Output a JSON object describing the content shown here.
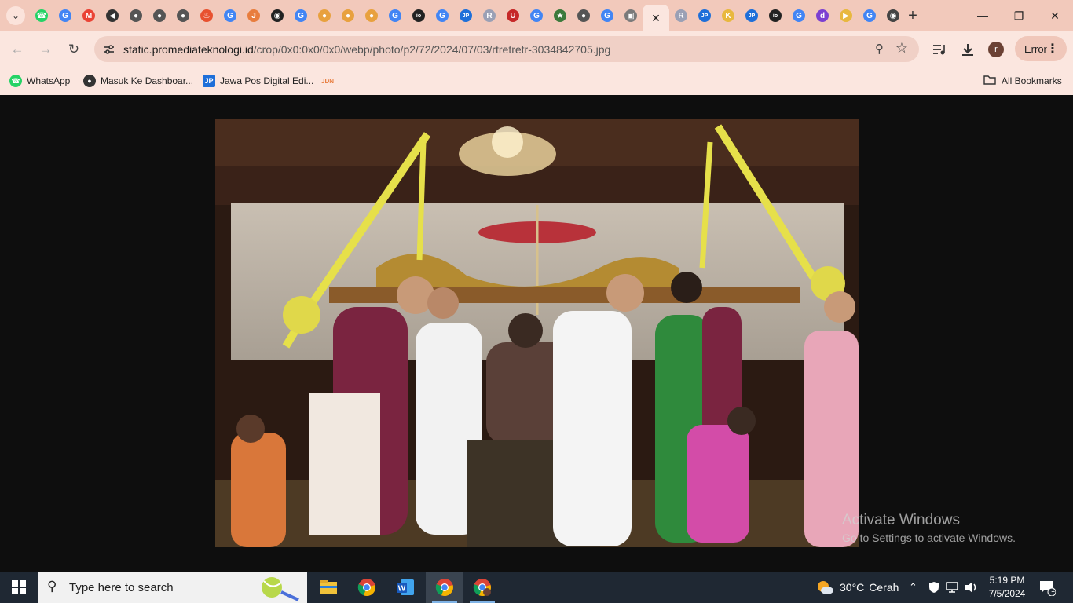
{
  "browser": {
    "tabs": [
      {
        "icon": "whatsapp-icon",
        "color": "#25d366"
      },
      {
        "icon": "google-icon",
        "color": "#4285f4"
      },
      {
        "icon": "gmail-icon",
        "color": "#ea4335"
      },
      {
        "icon": "speaker-icon",
        "color": "#333333"
      },
      {
        "icon": "globe-icon",
        "color": "#555555"
      },
      {
        "icon": "globe-icon",
        "color": "#555555"
      },
      {
        "icon": "globe-icon",
        "color": "#555555"
      },
      {
        "icon": "fire-icon",
        "color": "#e8512f"
      },
      {
        "icon": "google-icon",
        "color": "#4285f4"
      },
      {
        "icon": "jdn-icon",
        "color": "#e87d3e"
      },
      {
        "icon": "github-icon",
        "color": "#222222"
      },
      {
        "icon": "google-icon",
        "color": "#4285f4"
      },
      {
        "icon": "ball-icon",
        "color": "#e8a13e"
      },
      {
        "icon": "ball-icon",
        "color": "#e8a13e"
      },
      {
        "icon": "ball-icon",
        "color": "#e8a13e"
      },
      {
        "icon": "google-icon",
        "color": "#4285f4"
      },
      {
        "icon": "io-icon",
        "color": "#222222"
      },
      {
        "icon": "google-icon",
        "color": "#4285f4"
      },
      {
        "icon": "jp-icon",
        "color": "#1e6fd9"
      },
      {
        "icon": "r-icon",
        "color": "#9aa0b5"
      },
      {
        "icon": "u-icon",
        "color": "#c62828"
      },
      {
        "icon": "google-icon",
        "color": "#4285f4"
      },
      {
        "icon": "emblem-icon",
        "color": "#3c7a3c"
      },
      {
        "icon": "globe-icon",
        "color": "#555555"
      },
      {
        "icon": "google-icon",
        "color": "#4285f4"
      },
      {
        "icon": "image-icon",
        "color": "#7a7a7a"
      }
    ],
    "tabs_right": [
      {
        "icon": "r-icon",
        "color": "#9aa0b5"
      },
      {
        "icon": "jp-icon",
        "color": "#1e6fd9"
      },
      {
        "icon": "k-icon",
        "color": "#e8b83e"
      },
      {
        "icon": "jp-icon",
        "color": "#1e6fd9"
      },
      {
        "icon": "io-icon",
        "color": "#222222"
      },
      {
        "icon": "google-icon",
        "color": "#4285f4"
      },
      {
        "icon": "d-icon",
        "color": "#7b3fd1"
      },
      {
        "icon": "media-icon",
        "color": "#e8b83e"
      },
      {
        "icon": "google-icon",
        "color": "#4285f4"
      },
      {
        "icon": "github-icon",
        "color": "#444444"
      }
    ],
    "url_host": "static.promediateknologi.id",
    "url_path": "/crop/0x0:0x0/0x0/webp/photo/p2/72/2024/07/03/rtretretr-3034842705.jpg",
    "profile_initial": "r",
    "error_label": "Error",
    "bookmarks": [
      {
        "label": "WhatsApp",
        "icon": "whatsapp-icon",
        "color": "#25d366"
      },
      {
        "label": "Masuk Ke Dashboar...",
        "icon": "dashboard-icon",
        "color": "#333333"
      },
      {
        "label": "Jawa Pos Digital Edi...",
        "icon": "jp-icon",
        "color": "#1e6fd9"
      },
      {
        "label": "",
        "icon": "jdn-icon",
        "color": "#e87d3e"
      }
    ],
    "all_bookmarks_label": "All Bookmarks"
  },
  "watermark": {
    "line1": "Activate Windows",
    "line2": "Go to Settings to activate Windows."
  },
  "taskbar": {
    "search_placeholder": "Type here to search",
    "apps": [
      "file-explorer-icon",
      "chrome-icon",
      "word-icon",
      "chrome-icon",
      "chrome-icon"
    ],
    "weather_temp": "30°C",
    "weather_text": "Cerah",
    "time": "5:19 PM",
    "date": "7/5/2024",
    "notification_count": "1"
  }
}
